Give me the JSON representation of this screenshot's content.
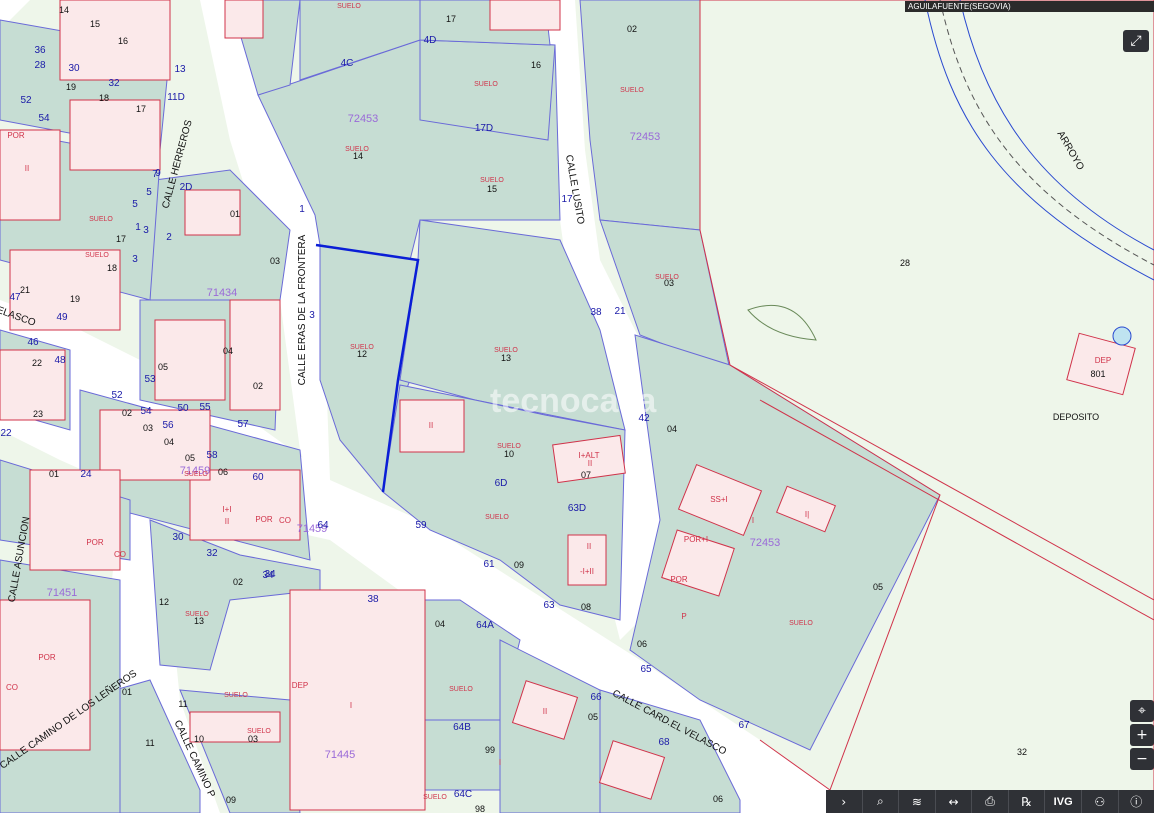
{
  "map": {
    "title": "AGUILAFUENTE(SEGOVIA)",
    "watermark": "tecnocasa",
    "colors": {
      "parcel": "#c6ddd3",
      "street": "#ffffff",
      "building": "#fbe9ea",
      "open_land": "#eef6ea",
      "parcel_border": "#6a6ad8",
      "building_border": "#d0334a",
      "selection": "#0a1ed6",
      "number": "#1a1aa8",
      "label": "#d0334a"
    },
    "streets": [
      {
        "id": "herreros",
        "text": "CALLE HERREROS"
      },
      {
        "id": "eras",
        "text": "CALLE ERAS DE LA FRONTERA"
      },
      {
        "id": "lusito",
        "text": "CALLE LUSITO"
      },
      {
        "id": "cardvelasco",
        "text": "CALLE CARD.EL VELASCO"
      },
      {
        "id": "lenleros",
        "text": "CALLE CAMINO DE LOS LEÑEROS"
      },
      {
        "id": "caminop",
        "text": "CALLE CAMINO P"
      },
      {
        "id": "asuncion",
        "text": "CALLE ASUNCION"
      },
      {
        "id": "velasco",
        "text": "VELASCO"
      },
      {
        "id": "arroyo",
        "text": "ARROYO"
      }
    ],
    "blocks": [
      {
        "id": "b1",
        "text": "72453"
      },
      {
        "id": "b2",
        "text": "72453"
      },
      {
        "id": "b3",
        "text": "71434"
      },
      {
        "id": "b4",
        "text": "71459"
      },
      {
        "id": "b5",
        "text": "71451"
      },
      {
        "id": "b6",
        "text": "71445"
      },
      {
        "id": "b7",
        "text": "72453"
      },
      {
        "id": "b8",
        "text": "71459"
      }
    ],
    "parcel_labels": [
      {
        "text": "17"
      },
      {
        "text": "16"
      },
      {
        "text": "14"
      },
      {
        "text": "15"
      },
      {
        "text": "12"
      },
      {
        "text": "13"
      },
      {
        "text": "10"
      },
      {
        "text": "07"
      },
      {
        "text": "09"
      },
      {
        "text": "08"
      },
      {
        "text": "02"
      },
      {
        "text": "03"
      },
      {
        "text": "04"
      },
      {
        "text": "05"
      },
      {
        "text": "06"
      },
      {
        "text": "28"
      },
      {
        "text": "801"
      },
      {
        "text": "32"
      },
      {
        "text": "01"
      },
      {
        "text": "03"
      },
      {
        "text": "02"
      },
      {
        "text": "05"
      },
      {
        "text": "04"
      },
      {
        "text": "13"
      },
      {
        "text": "12"
      },
      {
        "text": "02"
      },
      {
        "text": "03"
      },
      {
        "text": "04"
      },
      {
        "text": "99"
      },
      {
        "text": "98"
      },
      {
        "text": "05"
      },
      {
        "text": "06"
      },
      {
        "text": "01"
      },
      {
        "text": "11"
      },
      {
        "text": "09"
      },
      {
        "text": "10"
      },
      {
        "text": "11"
      },
      {
        "text": "19"
      },
      {
        "text": "18"
      },
      {
        "text": "17"
      },
      {
        "text": "16"
      },
      {
        "text": "15"
      },
      {
        "text": "14"
      },
      {
        "text": "19"
      },
      {
        "text": "18"
      },
      {
        "text": "17"
      },
      {
        "text": "21"
      },
      {
        "text": "22"
      },
      {
        "text": "23"
      },
      {
        "text": "01"
      },
      {
        "text": "02"
      },
      {
        "text": "03"
      },
      {
        "text": "04"
      },
      {
        "text": "05"
      },
      {
        "text": "06"
      }
    ],
    "street_numbers": [
      {
        "text": "4C"
      },
      {
        "text": "4D"
      },
      {
        "text": "17D"
      },
      {
        "text": "17"
      },
      {
        "text": "38"
      },
      {
        "text": "21"
      },
      {
        "text": "42"
      },
      {
        "text": "6D"
      },
      {
        "text": "63D"
      },
      {
        "text": "59"
      },
      {
        "text": "61"
      },
      {
        "text": "63"
      },
      {
        "text": "64A"
      },
      {
        "text": "65"
      },
      {
        "text": "66"
      },
      {
        "text": "68"
      },
      {
        "text": "67"
      },
      {
        "text": "64B"
      },
      {
        "text": "64C"
      },
      {
        "text": "38"
      },
      {
        "text": "34"
      },
      {
        "text": "32"
      },
      {
        "text": "30"
      },
      {
        "text": "64"
      },
      {
        "text": "60"
      },
      {
        "text": "58"
      },
      {
        "text": "56"
      },
      {
        "text": "54"
      },
      {
        "text": "52"
      },
      {
        "text": "50"
      },
      {
        "text": "55"
      },
      {
        "text": "57"
      },
      {
        "text": "53"
      },
      {
        "text": "49"
      },
      {
        "text": "48"
      },
      {
        "text": "46"
      },
      {
        "text": "47"
      },
      {
        "text": "2D"
      },
      {
        "text": "1"
      },
      {
        "text": "3"
      },
      {
        "text": "2"
      },
      {
        "text": "3"
      },
      {
        "text": "5"
      },
      {
        "text": "7"
      },
      {
        "text": "9"
      },
      {
        "text": "1"
      },
      {
        "text": "3"
      },
      {
        "text": "5"
      },
      {
        "text": "24"
      },
      {
        "text": "34"
      },
      {
        "text": "36"
      },
      {
        "text": "28"
      },
      {
        "text": "30"
      },
      {
        "text": "32"
      },
      {
        "text": "52"
      },
      {
        "text": "54"
      },
      {
        "text": "22"
      },
      {
        "text": "11D"
      },
      {
        "text": "13"
      }
    ],
    "land_labels": [
      {
        "text": "SUELO"
      },
      {
        "text": "SUELO"
      },
      {
        "text": "SUELO"
      },
      {
        "text": "SUELO"
      },
      {
        "text": "SUELO"
      },
      {
        "text": "SUELO"
      },
      {
        "text": "SUELO"
      },
      {
        "text": "SUELO"
      },
      {
        "text": "SUELO"
      },
      {
        "text": "SUELO"
      },
      {
        "text": "SUELO"
      },
      {
        "text": "SUELO"
      },
      {
        "text": "SUELO"
      },
      {
        "text": "SUELO"
      },
      {
        "text": "SUELO"
      },
      {
        "text": "SUELO"
      },
      {
        "text": "SUELO"
      },
      {
        "text": "SUELO"
      },
      {
        "text": "SUELO"
      }
    ],
    "building_labels": [
      {
        "text": "II"
      },
      {
        "text": "I+ALT"
      },
      {
        "text": "II"
      },
      {
        "text": "SS+I"
      },
      {
        "text": "I|"
      },
      {
        "text": "POR+I"
      },
      {
        "text": "POR"
      },
      {
        "text": "DEP"
      },
      {
        "text": "-I+II"
      },
      {
        "text": "II"
      },
      {
        "text": "I"
      },
      {
        "text": "DEP"
      },
      {
        "text": "I"
      },
      {
        "text": "II"
      },
      {
        "text": "I+I"
      },
      {
        "text": "II"
      },
      {
        "text": "POR"
      },
      {
        "text": "CO"
      },
      {
        "text": "POR"
      },
      {
        "text": "II"
      },
      {
        "text": "POR"
      },
      {
        "text": "CO"
      },
      {
        "text": "CO"
      },
      {
        "text": "POR"
      },
      {
        "text": "P"
      },
      {
        "text": "I"
      }
    ],
    "feature_labels": [
      {
        "text": "DEPOSITO"
      }
    ]
  },
  "toolbar": {
    "buttons": [
      {
        "name": "expand",
        "icon": "chevron-right-icon",
        "glyph": "›"
      },
      {
        "name": "search",
        "icon": "search-icon",
        "glyph": "⌕"
      },
      {
        "name": "layers",
        "icon": "layers-icon",
        "glyph": "≋"
      },
      {
        "name": "measure",
        "icon": "measure-icon",
        "glyph": "↔"
      },
      {
        "name": "print",
        "icon": "print-icon",
        "glyph": "⎙"
      },
      {
        "name": "reference",
        "icon": "reference-icon",
        "glyph": "℞"
      },
      {
        "name": "ivg",
        "icon": "ivg-icon",
        "glyph": "IVG"
      },
      {
        "name": "share",
        "icon": "share-icon",
        "glyph": "⚇"
      },
      {
        "name": "info",
        "icon": "info-icon",
        "glyph": "ⓘ"
      }
    ]
  },
  "controls": {
    "fullscreen": "⤢",
    "locate": "⌖",
    "zoom_in": "+",
    "zoom_out": "−"
  }
}
